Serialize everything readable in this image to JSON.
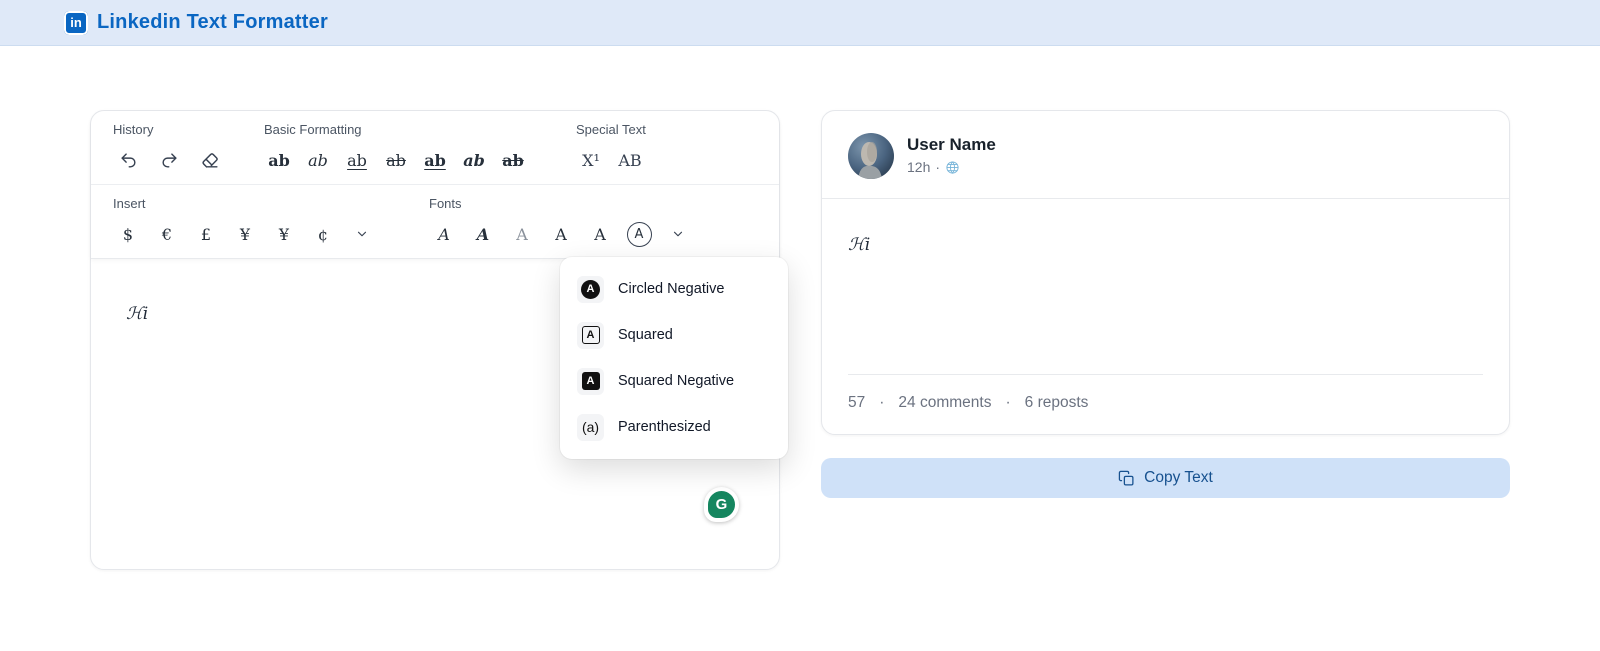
{
  "header": {
    "logo_text": "in",
    "title": "Linkedin Text Formatter"
  },
  "toolbar": {
    "history": {
      "label": "History",
      "icons": [
        "undo",
        "redo",
        "clear-formatting"
      ]
    },
    "basic_formatting": {
      "label": "Basic Formatting",
      "buttons": [
        {
          "style": "bold",
          "text": "ab"
        },
        {
          "style": "italic",
          "text": "ab"
        },
        {
          "style": "underline",
          "text": "ab"
        },
        {
          "style": "strikethrough",
          "text": "ab"
        },
        {
          "style": "bold-underline",
          "text": "ab"
        },
        {
          "style": "bold-italic",
          "text": "ab"
        },
        {
          "style": "bold-strikethrough",
          "text": "ab"
        }
      ]
    },
    "special_text": {
      "label": "Special Text",
      "buttons": [
        {
          "style": "superscript",
          "text": "X¹"
        },
        {
          "style": "fullwidth",
          "text": "AB"
        }
      ]
    },
    "insert": {
      "label": "Insert",
      "buttons": [
        "$",
        "€",
        "£",
        "¥",
        "¥",
        "¢"
      ]
    },
    "fonts": {
      "label": "Fonts",
      "buttons": [
        {
          "style": "script",
          "text": "A"
        },
        {
          "style": "fraktur",
          "text": "A"
        },
        {
          "style": "double-struck",
          "text": "A"
        },
        {
          "style": "serif",
          "text": "A"
        },
        {
          "style": "sans",
          "text": "A"
        },
        {
          "style": "circled",
          "text": "A"
        }
      ]
    }
  },
  "font_dropdown": {
    "items": [
      {
        "icon": "circled-negative",
        "icon_letter": "A",
        "label": "Circled Negative"
      },
      {
        "icon": "squared",
        "icon_letter": "A",
        "label": "Squared"
      },
      {
        "icon": "squared-negative",
        "icon_letter": "A",
        "label": "Squared Negative"
      },
      {
        "icon": "parenthesized",
        "icon_letter": "(a)",
        "label": "Parenthesized"
      }
    ]
  },
  "editor": {
    "content": "ℋi"
  },
  "grammarly": {
    "letter": "G"
  },
  "preview": {
    "user_name": "User Name",
    "timestamp": "12h",
    "meta_separator": "·",
    "post_text": "ℋi",
    "stats": {
      "reactions": "57",
      "separator1": "·",
      "comments": "24 comments",
      "separator2": "·",
      "reposts": "6 reposts"
    }
  },
  "copy_button": {
    "label": "Copy Text"
  },
  "colors": {
    "brand_blue": "#0a66c2",
    "header_bg": "#dfe9f8",
    "copy_button_bg": "#cfe1f8",
    "copy_button_text": "#17518f",
    "grammarly_green": "#15865f",
    "globe_blue": "#74b3d8"
  }
}
